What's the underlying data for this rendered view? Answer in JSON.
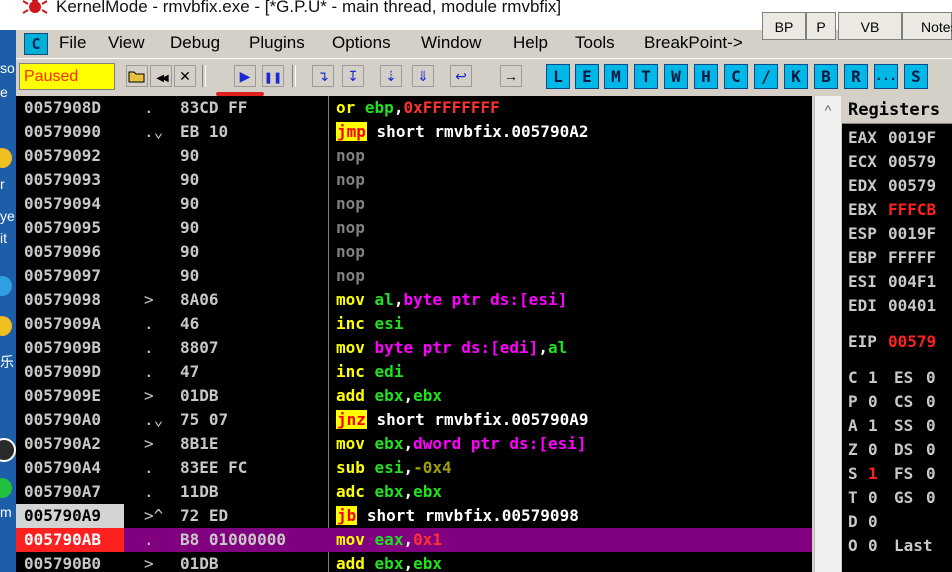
{
  "window": {
    "title": "KernelMode - rmvbfix.exe - [*G.P.U* - main thread, module rmvbfix]"
  },
  "desktop_strip": {
    "chars": [
      "so",
      "e",
      "r",
      "ye",
      "it",
      "乐",
      "m"
    ]
  },
  "menu": {
    "app_icon": "C",
    "items": [
      {
        "label": "File"
      },
      {
        "label": "View"
      },
      {
        "label": "Debug"
      },
      {
        "label": "Plugins"
      },
      {
        "label": "Options"
      },
      {
        "label": "Window"
      },
      {
        "label": "Help"
      },
      {
        "label": "Tools"
      },
      {
        "label": "BreakPoint->"
      }
    ]
  },
  "right_tabs": [
    {
      "label": "BP"
    },
    {
      "label": "P"
    },
    {
      "label": "VB"
    },
    {
      "label": "Notes"
    }
  ],
  "toolbar": {
    "status": "Paused",
    "buttons": [
      {
        "name": "open-icon",
        "glyph": "📂"
      },
      {
        "name": "restart-icon",
        "glyph": "◀◀"
      },
      {
        "name": "close-icon",
        "glyph": "✕"
      },
      {
        "name": "run-icon",
        "glyph": "▶"
      },
      {
        "name": "pause-icon",
        "glyph": "❚❚"
      },
      {
        "name": "step-into-icon",
        "glyph": "↴"
      },
      {
        "name": "step-over-icon",
        "glyph": "↧"
      },
      {
        "name": "trace-into-icon",
        "glyph": "⇣"
      },
      {
        "name": "trace-over-icon",
        "glyph": "⇓"
      },
      {
        "name": "execute-till-return-icon",
        "glyph": "↩"
      },
      {
        "name": "go-to-icon",
        "glyph": "→"
      }
    ],
    "letter_buttons": [
      "L",
      "E",
      "M",
      "T",
      "W",
      "H",
      "C",
      "/",
      "K",
      "B",
      "R",
      "...",
      "S"
    ]
  },
  "disassembly": {
    "rows": [
      {
        "addr": "0057908D",
        "mark": ".",
        "hex": "83CD FF",
        "mnem": "or",
        "mnem_style": "yellow",
        "ops": [
          [
            "reg",
            "ebp"
          ],
          [
            "plain",
            ","
          ],
          [
            "num",
            "0xFFFFFFFF"
          ]
        ]
      },
      {
        "addr": "00579090",
        "mark": ".⌄",
        "hex": "EB 10",
        "mnem": "jmp",
        "mnem_style": "jmp",
        "ops": [
          [
            "white",
            "short rmvbfix.005790A2"
          ]
        ]
      },
      {
        "addr": "00579092",
        "mark": "",
        "hex": "90",
        "mnem": "nop",
        "mnem_style": "grey",
        "ops": []
      },
      {
        "addr": "00579093",
        "mark": "",
        "hex": "90",
        "mnem": "nop",
        "mnem_style": "grey",
        "ops": []
      },
      {
        "addr": "00579094",
        "mark": "",
        "hex": "90",
        "mnem": "nop",
        "mnem_style": "grey",
        "ops": []
      },
      {
        "addr": "00579095",
        "mark": "",
        "hex": "90",
        "mnem": "nop",
        "mnem_style": "grey",
        "ops": []
      },
      {
        "addr": "00579096",
        "mark": "",
        "hex": "90",
        "mnem": "nop",
        "mnem_style": "grey",
        "ops": []
      },
      {
        "addr": "00579097",
        "mark": "",
        "hex": "90",
        "mnem": "nop",
        "mnem_style": "grey",
        "ops": []
      },
      {
        "addr": "00579098",
        "mark": ">",
        "hex": "8A06",
        "mnem": "mov",
        "mnem_style": "yellow",
        "ops": [
          [
            "reg",
            "al"
          ],
          [
            "plain",
            ","
          ],
          [
            "mem",
            "byte ptr ds:[esi]"
          ]
        ]
      },
      {
        "addr": "0057909A",
        "mark": ".",
        "hex": "46",
        "mnem": "inc",
        "mnem_style": "yellow",
        "ops": [
          [
            "reg",
            "esi"
          ]
        ]
      },
      {
        "addr": "0057909B",
        "mark": ".",
        "hex": "8807",
        "mnem": "mov",
        "mnem_style": "yellow",
        "ops": [
          [
            "mem",
            "byte ptr ds:[edi]"
          ],
          [
            "plain",
            ","
          ],
          [
            "reg",
            "al"
          ]
        ]
      },
      {
        "addr": "0057909D",
        "mark": ".",
        "hex": "47",
        "mnem": "inc",
        "mnem_style": "yellow",
        "ops": [
          [
            "reg",
            "edi"
          ]
        ]
      },
      {
        "addr": "0057909E",
        "mark": ">",
        "hex": "01DB",
        "mnem": "add",
        "mnem_style": "yellow",
        "ops": [
          [
            "reg",
            "ebx"
          ],
          [
            "plain",
            ","
          ],
          [
            "reg",
            "ebx"
          ]
        ]
      },
      {
        "addr": "005790A0",
        "mark": ".⌄",
        "hex": "75 07",
        "mnem": "jnz",
        "mnem_style": "jmp",
        "ops": [
          [
            "white",
            "short rmvbfix.005790A9"
          ]
        ]
      },
      {
        "addr": "005790A2",
        "mark": ">",
        "hex": "8B1E",
        "mnem": "mov",
        "mnem_style": "yellow",
        "ops": [
          [
            "reg",
            "ebx"
          ],
          [
            "plain",
            ","
          ],
          [
            "mem",
            "dword ptr ds:[esi]"
          ]
        ]
      },
      {
        "addr": "005790A4",
        "mark": ".",
        "hex": "83EE FC",
        "mnem": "sub",
        "mnem_style": "yellow",
        "ops": [
          [
            "reg",
            "esi"
          ],
          [
            "plain",
            ","
          ],
          [
            "neg",
            "-0x4"
          ]
        ]
      },
      {
        "addr": "005790A7",
        "mark": ".",
        "hex": "11DB",
        "mnem": "adc",
        "mnem_style": "yellow",
        "ops": [
          [
            "reg",
            "ebx"
          ],
          [
            "plain",
            ","
          ],
          [
            "reg",
            "ebx"
          ]
        ]
      },
      {
        "addr": "005790A9",
        "mark": ">^",
        "hex": "72 ED",
        "mnem": "jb",
        "mnem_style": "jmp",
        "ops": [
          [
            "white",
            "short rmvbfix.00579098"
          ]
        ],
        "state": "cur"
      },
      {
        "addr": "005790AB",
        "mark": ".",
        "hex": "B8 01000000",
        "mnem": "mov",
        "mnem_style": "yellow",
        "ops": [
          [
            "reg",
            "eax"
          ],
          [
            "plain",
            ","
          ],
          [
            "num",
            "0x1"
          ]
        ],
        "state": "eip"
      },
      {
        "addr": "005790B0",
        "mark": ">",
        "hex": "01DB",
        "mnem": "add",
        "mnem_style": "yellow",
        "ops": [
          [
            "reg",
            "ebx"
          ],
          [
            "plain",
            ","
          ],
          [
            "reg",
            "ebx"
          ]
        ]
      }
    ]
  },
  "registers": {
    "header": "Registers",
    "list": [
      {
        "name": "EAX",
        "value": "0019F",
        "highlight": false
      },
      {
        "name": "ECX",
        "value": "00579",
        "highlight": false
      },
      {
        "name": "EDX",
        "value": "00579",
        "highlight": false
      },
      {
        "name": "EBX",
        "value": "FFFCB",
        "highlight": true
      },
      {
        "name": "ESP",
        "value": "0019F",
        "highlight": false
      },
      {
        "name": "EBP",
        "value": "FFFFF",
        "highlight": false
      },
      {
        "name": "ESI",
        "value": "004F1",
        "highlight": false
      },
      {
        "name": "EDI",
        "value": "00401",
        "highlight": false
      }
    ],
    "eip": {
      "name": "EIP",
      "value": "00579",
      "highlight": true
    },
    "flags": [
      {
        "flag": "C",
        "value": "1",
        "seg": "ES",
        "segval": "0"
      },
      {
        "flag": "P",
        "value": "0",
        "seg": "CS",
        "segval": "0"
      },
      {
        "flag": "A",
        "value": "1",
        "seg": "SS",
        "segval": "0"
      },
      {
        "flag": "Z",
        "value": "0",
        "seg": "DS",
        "segval": "0"
      },
      {
        "flag": "S",
        "value": "1",
        "seg": "FS",
        "segval": "0",
        "red": true
      },
      {
        "flag": "T",
        "value": "0",
        "seg": "GS",
        "segval": "0"
      },
      {
        "flag": "D",
        "value": "0",
        "seg": "",
        "segval": ""
      },
      {
        "flag": "O",
        "value": "0",
        "seg": "Last",
        "segval": ""
      }
    ]
  },
  "colors": {
    "disasm_bg": "#000000",
    "selection": "#800080",
    "eip_row": "#ff2020",
    "status_bg": "#ffff00",
    "toolbar_letter_bg": "#00b8e8"
  }
}
